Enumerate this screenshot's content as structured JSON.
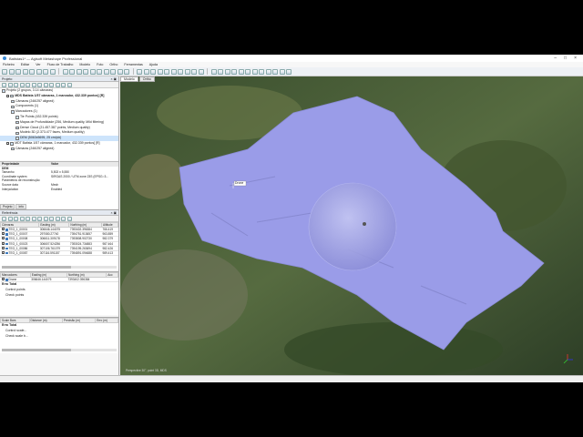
{
  "window": {
    "title": "Batistas1* — Agisoft Metashape Professional"
  },
  "menu": [
    "Ficheiro",
    "Editar",
    "Ver",
    "Fluxo de Trabalho",
    "Modelo",
    "Foto",
    "Ortho",
    "Ferramentas",
    "Ajuda"
  ],
  "project": {
    "panel_title": "Projeto",
    "root": "Projeto (2 grupos, 3.14 câmaras)",
    "items": [
      {
        "text": "MDS Batista 1/57 câmaras, 1 marcador, 432.339 pontos] [R]",
        "indent": 1,
        "bold": true
      },
      {
        "text": "Câmaras (246/257 aligned)",
        "indent": 2
      },
      {
        "text": "Components (1)",
        "indent": 2
      },
      {
        "text": "Marcadores (1)",
        "indent": 2
      },
      {
        "text": "Tie Points (432.339 points)",
        "indent": 3
      },
      {
        "text": "Mapas de Profundidade (256, Medium quality, Mild filtering)",
        "indent": 3
      },
      {
        "text": "Dense Cloud (21.457.387 points, Medium quality)",
        "indent": 3
      },
      {
        "text": "Modelo 3D (2.373.477 faces, Medium quality)",
        "indent": 3
      },
      {
        "text": "DEM (5063x5695, 25 cm/pix)",
        "indent": 3,
        "selected": true
      },
      {
        "text": "MDT Batista 1/57 câmaras, 1 marcador, 432.339 pontos] [R]",
        "indent": 1
      },
      {
        "text": "Câmaras (246/257 aligned)",
        "indent": 2
      }
    ]
  },
  "properties": {
    "header": [
      "Propriedade",
      "Valor"
    ],
    "section": "DEM",
    "rows": [
      [
        "Tamanho",
        "5,502 x 5,550"
      ],
      [
        "Coordinate system",
        "SIRGAS 2000 / UTM zone 23S (EPSG::3..."
      ],
      [
        "Parâmetros de reconstrução",
        ""
      ],
      [
        "Source data",
        "Mesh"
      ],
      [
        "Interpolation",
        "Enabled"
      ]
    ],
    "tabs": [
      "Projeto",
      "Info"
    ]
  },
  "reference": {
    "panel_title": "Referência",
    "headers": [
      "Câmaras",
      "Easting (m)",
      "Northing (m)",
      "Altitude"
    ],
    "rows": [
      [
        "TEO_1_00001",
        "306646.144075",
        "7393402.396384",
        "766.419"
      ],
      [
        "TEO_1_00007",
        "297080.27740",
        "7394751.913657",
        "963.859"
      ],
      [
        "TEO_1_00008",
        "306611.309178",
        "7393808.902730",
        "982.379"
      ],
      [
        "TEO_1_00023",
        "306607.524256",
        "7393024.734883",
        "987.464"
      ],
      [
        "TEO_1_00086",
        "307106.761079",
        "7394195.263694",
        "982.426"
      ],
      [
        "TEO_1_00087",
        "307116.591157",
        "7394891.094688",
        "989.413"
      ]
    ]
  },
  "markers": {
    "headers": [
      "Marcadores",
      "Easting (m)",
      "Northing (m)",
      "Acc"
    ],
    "rows": [
      [
        "Drone",
        "306646.144075",
        "7393402.396384",
        ""
      ]
    ],
    "total_label": "Erro Total",
    "sub_items": [
      "Control points",
      "Check points"
    ]
  },
  "scalebars": {
    "headers": [
      "Scale Bars",
      "Distance (m)",
      "Precisão (m)",
      "Erro (m)"
    ],
    "total_label": "Erro Total",
    "sub_items": [
      "Control scale...",
      "Check scale b..."
    ]
  },
  "viewport": {
    "tabs": [
      "Modelo",
      "Ortho"
    ],
    "marker_label": "Drone",
    "bottom_text": "Perspective 30°, point 3D, MDS"
  },
  "colors": {
    "dem_overlay": "#9a9ce8",
    "terrain": "#4a6238",
    "accent": "#3f7bbf"
  }
}
